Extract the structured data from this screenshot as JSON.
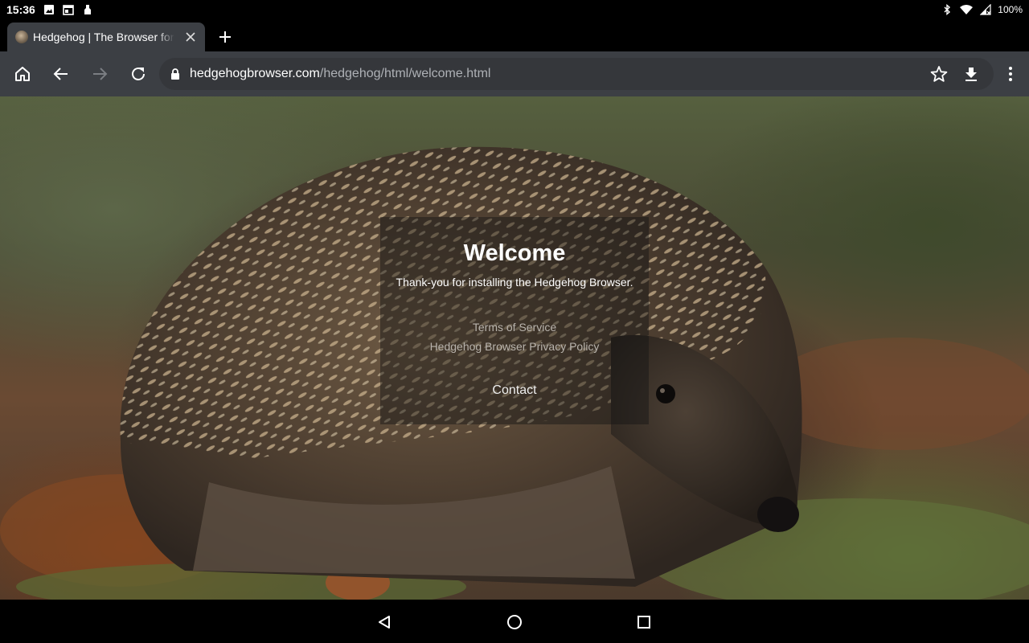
{
  "status_bar": {
    "time": "15:36",
    "battery": "100%",
    "left_icons": [
      "image-icon",
      "calendar-icon",
      "usb-icon"
    ],
    "right_icons": [
      "bluetooth-icon",
      "wifi-icon",
      "signal-icon"
    ]
  },
  "tabs": [
    {
      "title": "Hedgehog | The Browser for Ch",
      "favicon": "hedgehog-favicon-icon"
    }
  ],
  "toolbar": {
    "url_host": "hedgehogbrowser.com",
    "url_path": "/hedgehog/html/welcome.html",
    "icons": [
      "home-icon",
      "back-icon",
      "forward-icon",
      "reload-icon",
      "lock-icon",
      "star-icon",
      "download-icon",
      "menu-icon"
    ]
  },
  "page": {
    "title": "Welcome",
    "subtitle": "Thank-you for installing the Hedgehog Browser.",
    "links": {
      "terms": "Terms of Service",
      "privacy": "Hedgehog Browser Privacy Policy",
      "contact": "Contact"
    }
  },
  "nav_bar": {
    "icons": [
      "back-triangle-icon",
      "home-circle-icon",
      "recents-square-icon"
    ]
  },
  "colors": {
    "toolbar": "#3c3f44",
    "omnibox": "#35373b",
    "status_bar": "#000000",
    "url_path": "#aeb1b6",
    "link_muted": "#b9b4ad"
  }
}
